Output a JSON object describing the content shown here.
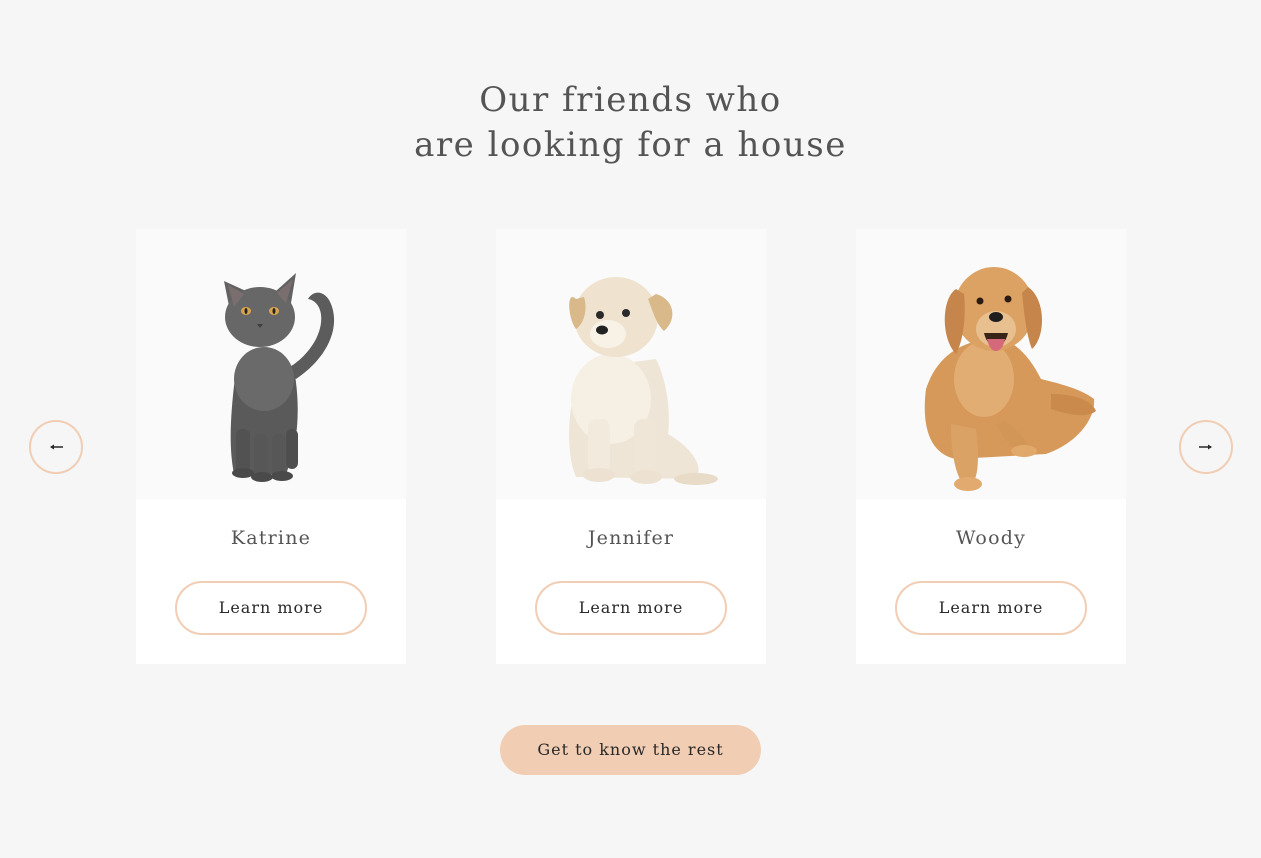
{
  "section": {
    "title_line1": "Our friends who",
    "title_line2": "are looking for a house"
  },
  "slider": {
    "prev_icon": "arrow-left-icon",
    "next_icon": "arrow-right-icon",
    "pets": [
      {
        "name": "Katrine",
        "button_label": "Learn more",
        "image": "gray-cat"
      },
      {
        "name": "Jennifer",
        "button_label": "Learn more",
        "image": "cream-puppy"
      },
      {
        "name": "Woody",
        "button_label": "Learn more",
        "image": "golden-retriever"
      }
    ]
  },
  "cta": {
    "label": "Get to know the rest"
  },
  "colors": {
    "background": "#f6f6f6",
    "accent": "#f1cdb3",
    "card": "#ffffff",
    "heading": "#545454",
    "button_text": "#292929"
  }
}
